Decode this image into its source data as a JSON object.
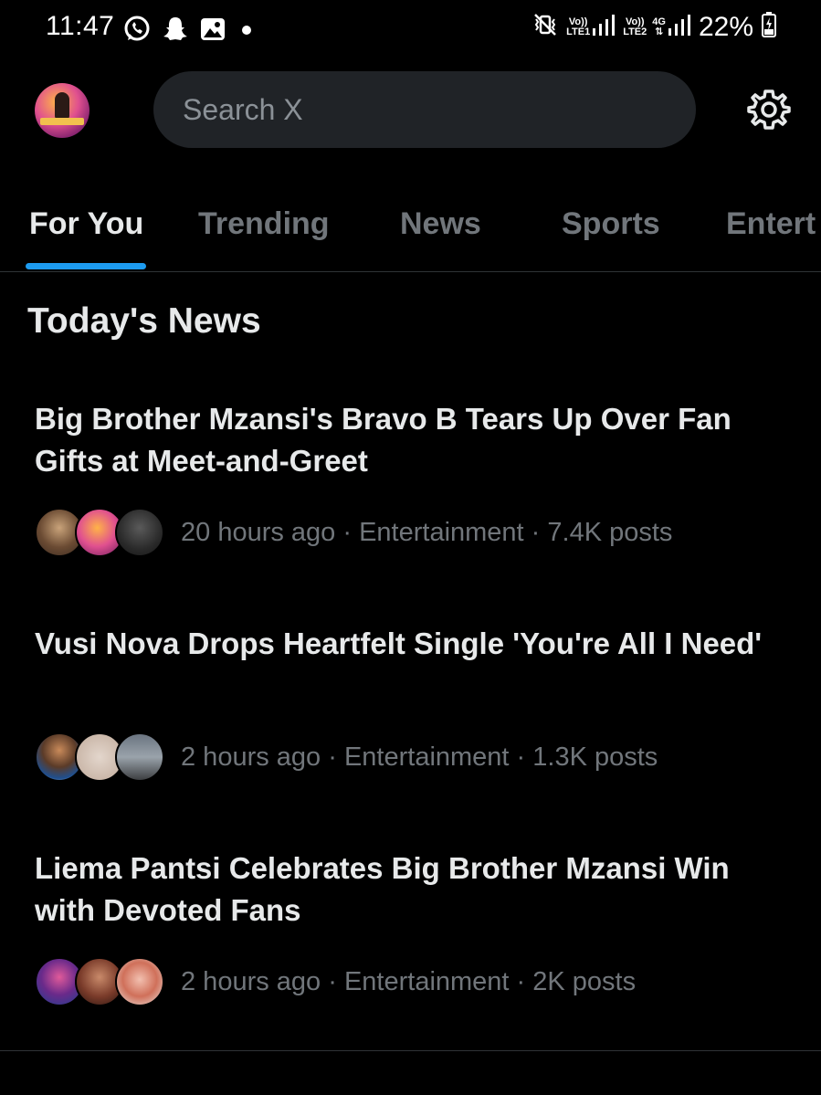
{
  "status_bar": {
    "time": "11:47",
    "left_icons": [
      "whatsapp-icon",
      "snapchat-icon",
      "gallery-icon",
      "notification-dot-icon"
    ],
    "sim1_label_top": "Vo))",
    "sim1_label_bottom": "LTE1",
    "sim2_label_top": "Vo))",
    "sim2_label_bottom": "LTE2",
    "network_type": "4G",
    "battery": "22%"
  },
  "top_bar": {
    "search_placeholder": "Search X"
  },
  "tabs": [
    {
      "label": "For You",
      "active": true
    },
    {
      "label": "Trending",
      "active": false
    },
    {
      "label": "News",
      "active": false
    },
    {
      "label": "Sports",
      "active": false
    },
    {
      "label": "Entert",
      "active": false
    }
  ],
  "section": {
    "title": "Today's News"
  },
  "news": [
    {
      "title": "Big Brother Mzansi's Bravo B Tears Up Over Fan Gifts at Meet-and-Greet",
      "meta": "20 hours ago · Entertainment · 7.4K posts"
    },
    {
      "title": "Vusi Nova Drops Heartfelt Single 'You're All I Need'",
      "meta": "2 hours ago · Entertainment · 1.3K posts"
    },
    {
      "title": "Liema Pantsi Celebrates Big Brother Mzansi Win with Devoted Fans",
      "meta": "2 hours ago · Entertainment · 2K posts"
    }
  ],
  "colors": {
    "background": "#000000",
    "primary_text": "#e7e9ea",
    "secondary_text": "#71767b",
    "accent": "#1d9bf0",
    "search_bg": "#202327",
    "divider": "#2f3336"
  }
}
